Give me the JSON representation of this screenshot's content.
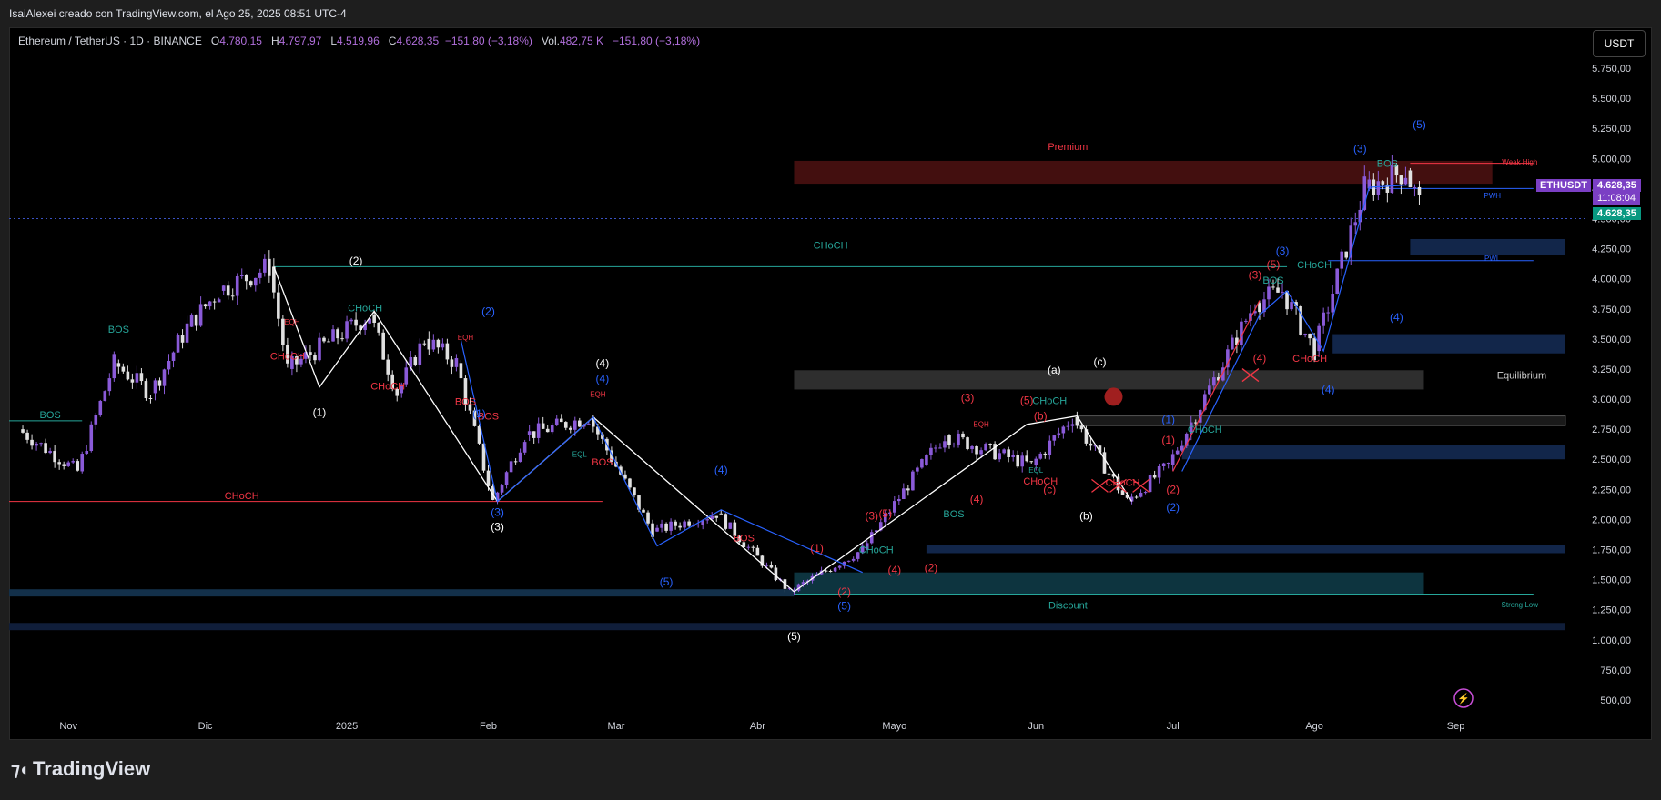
{
  "header": {
    "credit": "IsaiAlexei creado con TradingView.com, el Ago 25, 2025 08:51 UTC-4",
    "symbol_line": "Ethereum / TetherUS · 1D · BINANCE",
    "o_label": "O",
    "o_value": "4.780,15",
    "h_label": "H",
    "h_value": "4.797,97",
    "l_label": "L",
    "l_value": "4.519,96",
    "c_label": "C",
    "c_value": "4.628,35",
    "change": "−151,80 (−3,18%)",
    "vol_label": "Vol.",
    "vol_value": "482,75 K",
    "vol_change": "−151,80 (−3,18%)"
  },
  "currency_button": "USDT",
  "ticker_tag": "ETHUSDT",
  "last_price": "4.628,35",
  "countdown": "11:08:04",
  "footer_brand": "TradingView",
  "colors": {
    "bull": "#8a5ad8",
    "bear": "#e0e0e0",
    "red": "#f23645",
    "teal": "#26a69a",
    "blue": "#2962ff",
    "white": "#ffffff",
    "purple": "#b16fdc"
  },
  "chart_data": {
    "type": "candlestick",
    "ylim": [
      500,
      5750
    ],
    "y_ticks": [
      "5.750,00",
      "5.500,00",
      "5.250,00",
      "5.000,00",
      "4.750,00",
      "4.500,00",
      "4.250,00",
      "4.000,00",
      "3.750,00",
      "3.500,00",
      "3.250,00",
      "3.000,00",
      "2.750,00",
      "2.500,00",
      "2.250,00",
      "2.000,00",
      "1.750,00",
      "1.500,00",
      "1.250,00",
      "1.000,00",
      "750,00",
      "500,00"
    ],
    "y_tick_values": [
      5750,
      5500,
      5250,
      5000,
      4750,
      4500,
      4250,
      4000,
      3750,
      3500,
      3250,
      3000,
      2750,
      2500,
      2250,
      2000,
      1750,
      1500,
      1250,
      1000,
      750,
      500
    ],
    "x_ticks": [
      "Nov",
      "Dic",
      "2025",
      "Feb",
      "Mar",
      "Abr",
      "Mayo",
      "Jun",
      "Jul",
      "Ago",
      "Sep"
    ],
    "price_path": [
      {
        "d": "2024-10-22",
        "p": 2750
      },
      {
        "d": "2024-11-04",
        "p": 2400
      },
      {
        "d": "2024-11-12",
        "p": 3300
      },
      {
        "d": "2024-11-20",
        "p": 3050
      },
      {
        "d": "2024-11-28",
        "p": 3600
      },
      {
        "d": "2024-12-05",
        "p": 3900
      },
      {
        "d": "2024-12-16",
        "p": 4100
      },
      {
        "d": "2024-12-20",
        "p": 3250
      },
      {
        "d": "2025-01-07",
        "p": 3700
      },
      {
        "d": "2025-01-13",
        "p": 3050
      },
      {
        "d": "2025-01-19",
        "p": 3500
      },
      {
        "d": "2025-01-26",
        "p": 3300
      },
      {
        "d": "2025-02-03",
        "p": 2150
      },
      {
        "d": "2025-02-10",
        "p": 2700
      },
      {
        "d": "2025-02-24",
        "p": 2850
      },
      {
        "d": "2025-03-10",
        "p": 1900
      },
      {
        "d": "2025-03-24",
        "p": 2050
      },
      {
        "d": "2025-04-09",
        "p": 1400
      },
      {
        "d": "2025-04-25",
        "p": 1750
      },
      {
        "d": "2025-05-08",
        "p": 2450
      },
      {
        "d": "2025-05-13",
        "p": 2700
      },
      {
        "d": "2025-06-01",
        "p": 2450
      },
      {
        "d": "2025-06-10",
        "p": 2850
      },
      {
        "d": "2025-06-22",
        "p": 2150
      },
      {
        "d": "2025-07-01",
        "p": 2450
      },
      {
        "d": "2025-07-20",
        "p": 3800
      },
      {
        "d": "2025-07-26",
        "p": 3900
      },
      {
        "d": "2025-08-02",
        "p": 3400
      },
      {
        "d": "2025-08-13",
        "p": 4750
      },
      {
        "d": "2025-08-22",
        "p": 4900
      },
      {
        "d": "2025-08-25",
        "p": 4628
      }
    ],
    "labels": [
      {
        "t": "BOS",
        "c": "teal",
        "d": "2024-11-12",
        "p": 3550
      },
      {
        "t": "BOS",
        "c": "teal",
        "d": "2024-10-28",
        "p": 2840
      },
      {
        "t": "CHoCH",
        "c": "red",
        "d": "2024-12-19",
        "p": 3330
      },
      {
        "t": "CHoCH",
        "c": "teal",
        "d": "2025-01-05",
        "p": 3730
      },
      {
        "t": "CHoCH",
        "c": "red",
        "d": "2025-01-10",
        "p": 3080
      },
      {
        "t": "CHoCH",
        "c": "red",
        "d": "2024-12-09",
        "p": 2170
      },
      {
        "t": "BOS",
        "c": "red",
        "d": "2025-01-27",
        "p": 2950
      },
      {
        "t": "BOS",
        "c": "red",
        "d": "2025-02-01",
        "p": 2830
      },
      {
        "t": "BOS",
        "c": "red",
        "d": "2025-02-26",
        "p": 2450
      },
      {
        "t": "BOS",
        "c": "red",
        "d": "2025-03-29",
        "p": 1820
      },
      {
        "t": "CHoCH",
        "c": "teal",
        "d": "2025-04-17",
        "p": 4250
      },
      {
        "t": "CHoCH",
        "c": "teal",
        "d": "2025-04-27",
        "p": 1720
      },
      {
        "t": "BOS",
        "c": "teal",
        "d": "2025-05-14",
        "p": 2020
      },
      {
        "t": "CHoCH",
        "c": "teal",
        "d": "2025-06-04",
        "p": 2960
      },
      {
        "t": "CHoCH",
        "c": "red",
        "d": "2025-06-02",
        "p": 2290
      },
      {
        "t": "CHoCH",
        "c": "teal",
        "d": "2025-07-08",
        "p": 2720
      },
      {
        "t": "BOS",
        "c": "teal",
        "d": "2025-07-23",
        "p": 3960
      },
      {
        "t": "CHoCH",
        "c": "teal",
        "d": "2025-08-01",
        "p": 4090
      },
      {
        "t": "CHoCH",
        "c": "red",
        "d": "2025-07-31",
        "p": 3310
      },
      {
        "t": "BOS",
        "c": "teal",
        "d": "2025-08-17",
        "p": 4930
      },
      {
        "t": "CHoCH",
        "c": "red",
        "d": "2025-06-20",
        "p": 2280
      }
    ],
    "waves": [
      {
        "t": "(1)",
        "c": "white",
        "d": "2024-12-26",
        "p": 2860
      },
      {
        "t": "(2)",
        "c": "white",
        "d": "2025-01-03",
        "p": 4120
      },
      {
        "t": "(3)",
        "c": "white",
        "d": "2025-02-03",
        "p": 1910
      },
      {
        "t": "(4)",
        "c": "white",
        "d": "2025-02-26",
        "p": 3270
      },
      {
        "t": "(5)",
        "c": "white",
        "d": "2025-04-09",
        "p": 1000
      },
      {
        "t": "(a)",
        "c": "white",
        "d": "2025-06-05",
        "p": 3210
      },
      {
        "t": "(b)",
        "c": "white",
        "d": "2025-06-12",
        "p": 2000
      },
      {
        "t": "(c)",
        "c": "white",
        "d": "2025-06-15",
        "p": 3280
      },
      {
        "t": "(2)",
        "c": "blue",
        "d": "2025-02-01",
        "p": 3700
      },
      {
        "t": "(1)",
        "c": "blue",
        "d": "2025-01-30",
        "p": 2850
      },
      {
        "t": "(3)",
        "c": "blue",
        "d": "2025-02-03",
        "p": 2030
      },
      {
        "t": "(4)",
        "c": "blue",
        "d": "2025-02-26",
        "p": 3140
      },
      {
        "t": "(5)",
        "c": "blue",
        "d": "2025-03-12",
        "p": 1450
      },
      {
        "t": "(4)",
        "c": "blue",
        "d": "2025-03-24",
        "p": 2380
      },
      {
        "t": "(5)",
        "c": "blue",
        "d": "2025-04-20",
        "p": 1250
      },
      {
        "t": "(2)",
        "c": "red",
        "d": "2025-04-20",
        "p": 1370
      },
      {
        "t": "(1)",
        "c": "red",
        "d": "2025-04-14",
        "p": 1730
      },
      {
        "t": "(3)",
        "c": "red",
        "d": "2025-04-26",
        "p": 2000
      },
      {
        "t": "(5)",
        "c": "red",
        "d": "2025-04-29",
        "p": 2020
      },
      {
        "t": "(4)",
        "c": "red",
        "d": "2025-05-01",
        "p": 1550
      },
      {
        "t": "(2)",
        "c": "red",
        "d": "2025-05-09",
        "p": 1570
      },
      {
        "t": "(3)",
        "c": "red",
        "d": "2025-05-17",
        "p": 2980
      },
      {
        "t": "(4)",
        "c": "red",
        "d": "2025-05-19",
        "p": 2140
      },
      {
        "t": "(5)",
        "c": "red",
        "d": "2025-05-30",
        "p": 2960
      },
      {
        "t": "(b)",
        "c": "red",
        "d": "2025-06-02",
        "p": 2830
      },
      {
        "t": "(c)",
        "c": "red",
        "d": "2025-06-04",
        "p": 2220
      },
      {
        "t": "(1)",
        "c": "red",
        "d": "2025-06-30",
        "p": 2630
      },
      {
        "t": "(2)",
        "c": "red",
        "d": "2025-07-01",
        "p": 2220
      },
      {
        "t": "(1)",
        "c": "blue",
        "d": "2025-06-30",
        "p": 2800
      },
      {
        "t": "(2)",
        "c": "blue",
        "d": "2025-07-01",
        "p": 2070
      },
      {
        "t": "(3)",
        "c": "red",
        "d": "2025-07-19",
        "p": 4000
      },
      {
        "t": "(5)",
        "c": "red",
        "d": "2025-07-23",
        "p": 4090
      },
      {
        "t": "(3)",
        "c": "blue",
        "d": "2025-07-25",
        "p": 4200
      },
      {
        "t": "(4)",
        "c": "red",
        "d": "2025-07-20",
        "p": 3310
      },
      {
        "t": "(4)",
        "c": "blue",
        "d": "2025-08-04",
        "p": 3050
      },
      {
        "t": "(3)",
        "c": "blue",
        "d": "2025-08-11",
        "p": 5050
      },
      {
        "t": "(4)",
        "c": "blue",
        "d": "2025-08-19",
        "p": 3650
      },
      {
        "t": "(5)",
        "c": "blue",
        "d": "2025-08-24",
        "p": 5250
      }
    ],
    "zones": [
      {
        "t": "Premium",
        "c": "red",
        "d": "2025-06-08",
        "p": 5070
      },
      {
        "t": "Equilibrium",
        "c": "grey",
        "d": "2025-09-10",
        "p": 3170
      },
      {
        "t": "Discount",
        "c": "teal",
        "d": "2025-06-08",
        "p": 1260
      },
      {
        "t": "Weak High",
        "c": "red",
        "d": "2025-09-15",
        "p": 4950
      },
      {
        "t": "Strong Low",
        "c": "teal",
        "d": "2025-09-15",
        "p": 1270
      },
      {
        "t": "PWH",
        "c": "blue",
        "d": "2025-09-09",
        "p": 4670
      },
      {
        "t": "PWL",
        "c": "blue",
        "d": "2025-09-09",
        "p": 4150
      },
      {
        "t": "EQH",
        "c": "red",
        "d": "2024-12-20",
        "p": 3620
      },
      {
        "t": "EQH",
        "c": "red",
        "d": "2025-01-27",
        "p": 3490
      },
      {
        "t": "EQH",
        "c": "red",
        "d": "2025-02-25",
        "p": 3020
      },
      {
        "t": "EQH",
        "c": "red",
        "d": "2025-05-20",
        "p": 2770
      },
      {
        "t": "EQL",
        "c": "teal",
        "d": "2025-02-21",
        "p": 2520
      },
      {
        "t": "EQL",
        "c": "teal",
        "d": "2025-06-01",
        "p": 2390
      }
    ]
  }
}
